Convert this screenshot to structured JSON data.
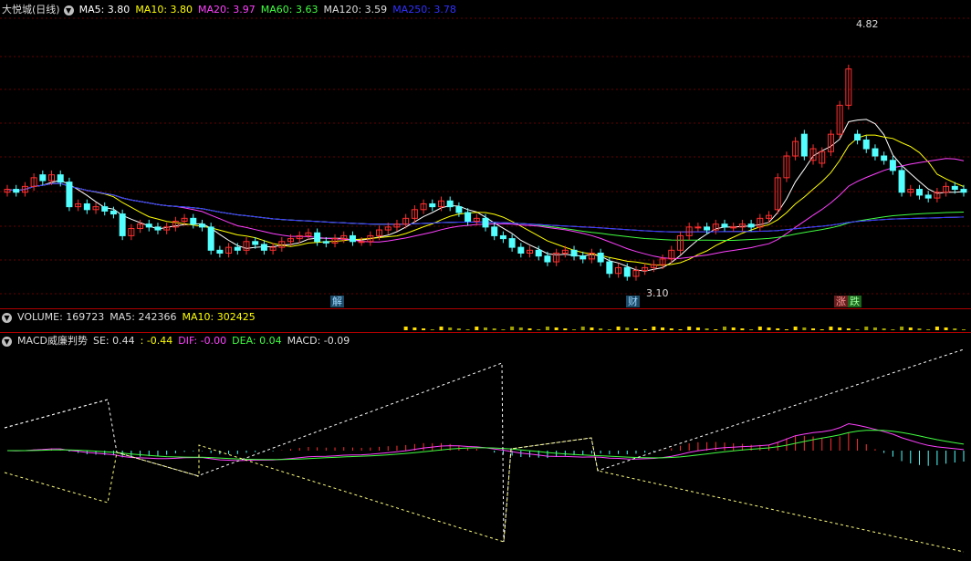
{
  "price_panel": {
    "title": "大悦城(日线)",
    "ma_items": [
      {
        "label": "MA5: 3.80",
        "color": "#ffffff"
      },
      {
        "label": "MA10: 3.80",
        "color": "#ffff00"
      },
      {
        "label": "MA20: 3.97",
        "color": "#ff40ff"
      },
      {
        "label": "MA60: 3.63",
        "color": "#40ff40"
      },
      {
        "label": "MA120: 3.59",
        "color": "#dddddd"
      },
      {
        "label": "MA250: 3.78",
        "color": "#3030ff"
      }
    ],
    "high_label": "4.82",
    "low_label": "3.10",
    "tags": [
      {
        "text": "解",
        "bg": "#1d4a66",
        "color": "#9ad6ff"
      },
      {
        "text": "财",
        "bg": "#1d4a66",
        "color": "#9ad6ff"
      },
      {
        "text": "涨",
        "bg": "#661d1d",
        "color": "#ff9a9a"
      },
      {
        "text": "跌",
        "bg": "#1d661d",
        "color": "#9aff9a"
      }
    ]
  },
  "volume_panel": {
    "items": [
      {
        "label": "VOLUME: 169723",
        "color": "#dddddd"
      },
      {
        "label": "MA5: 242366",
        "color": "#dddddd"
      },
      {
        "label": "MA10: 302425",
        "color": "#ffff00"
      }
    ]
  },
  "macd_panel": {
    "items": [
      {
        "label": "MACD威廉判势",
        "color": "#dddddd"
      },
      {
        "label": "SE: 0.44",
        "color": "#dddddd"
      },
      {
        "label": ": -0.44",
        "color": "#ffff00"
      },
      {
        "label": "DIF: -0.00",
        "color": "#ff40ff"
      },
      {
        "label": "DEA: 0.04",
        "color": "#40ff40"
      },
      {
        "label": "MACD: -0.09",
        "color": "#dddddd"
      }
    ]
  },
  "colors": {
    "up": "#ff3030",
    "down": "#54ffff",
    "separator": "#b00000",
    "grid": "#660000"
  },
  "chart_data": {
    "type": "candlestick",
    "price_range": [
      3.0,
      4.9
    ],
    "closes": [
      3.72,
      3.7,
      3.74,
      3.8,
      3.78,
      3.82,
      3.77,
      3.6,
      3.62,
      3.58,
      3.6,
      3.57,
      3.55,
      3.4,
      3.45,
      3.48,
      3.46,
      3.44,
      3.46,
      3.5,
      3.52,
      3.48,
      3.46,
      3.3,
      3.28,
      3.32,
      3.3,
      3.36,
      3.34,
      3.3,
      3.32,
      3.36,
      3.38,
      3.4,
      3.42,
      3.36,
      3.35,
      3.38,
      3.4,
      3.36,
      3.36,
      3.4,
      3.44,
      3.46,
      3.48,
      3.52,
      3.58,
      3.62,
      3.6,
      3.64,
      3.6,
      3.56,
      3.5,
      3.52,
      3.46,
      3.4,
      3.38,
      3.32,
      3.28,
      3.3,
      3.26,
      3.22,
      3.28,
      3.3,
      3.26,
      3.24,
      3.28,
      3.22,
      3.14,
      3.18,
      3.12,
      3.16,
      3.18,
      3.2,
      3.24,
      3.3,
      3.4,
      3.46,
      3.46,
      3.44,
      3.48,
      3.46,
      3.46,
      3.48,
      3.46,
      3.52,
      3.54,
      3.8,
      3.95,
      4.05,
      3.95,
      4.0,
      3.98,
      4.1,
      4.3,
      4.55,
      4.06,
      4.0,
      3.95,
      3.92,
      3.85,
      3.7,
      3.72,
      3.68,
      3.66,
      3.7,
      3.74,
      3.72,
      3.7
    ],
    "opens": [
      3.7,
      3.72,
      3.7,
      3.74,
      3.82,
      3.78,
      3.82,
      3.77,
      3.6,
      3.62,
      3.58,
      3.6,
      3.57,
      3.55,
      3.4,
      3.45,
      3.48,
      3.46,
      3.44,
      3.46,
      3.5,
      3.52,
      3.48,
      3.46,
      3.3,
      3.28,
      3.32,
      3.3,
      3.36,
      3.34,
      3.3,
      3.32,
      3.36,
      3.38,
      3.4,
      3.42,
      3.36,
      3.35,
      3.38,
      3.4,
      3.36,
      3.36,
      3.4,
      3.44,
      3.46,
      3.48,
      3.52,
      3.58,
      3.62,
      3.6,
      3.64,
      3.6,
      3.56,
      3.5,
      3.52,
      3.46,
      3.4,
      3.38,
      3.32,
      3.28,
      3.3,
      3.26,
      3.22,
      3.28,
      3.3,
      3.26,
      3.24,
      3.28,
      3.22,
      3.14,
      3.18,
      3.12,
      3.16,
      3.18,
      3.2,
      3.24,
      3.3,
      3.4,
      3.46,
      3.46,
      3.44,
      3.48,
      3.46,
      3.46,
      3.48,
      3.46,
      3.52,
      3.58,
      3.8,
      3.95,
      4.1,
      3.92,
      3.9,
      3.98,
      4.1,
      4.3,
      4.1,
      4.06,
      4.0,
      3.95,
      3.92,
      3.85,
      3.7,
      3.72,
      3.68,
      3.66,
      3.7,
      3.74,
      3.72
    ]
  }
}
